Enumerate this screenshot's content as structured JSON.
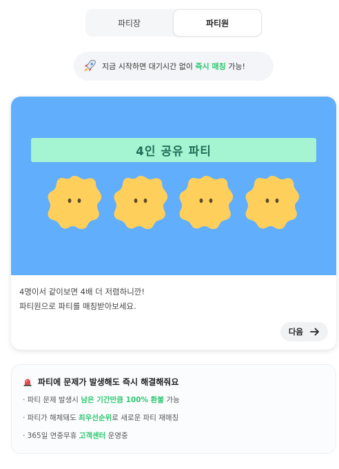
{
  "tabs": [
    {
      "label": "파티장",
      "active": false
    },
    {
      "label": "파티원",
      "active": true
    }
  ],
  "banner": {
    "icon": "rocket-icon",
    "prefix": "지금 시작하면 대기시간 없이 ",
    "highlight": "즉시 매칭",
    "suffix": " 가능!"
  },
  "card": {
    "hero_label": "4인 공유 파티",
    "hero_bg": "#61aefc",
    "members_count": 4,
    "desc_line1": "4명이서 같이보면 4배 더 저렴하니깐!",
    "desc_line2": "파티원으로 파티를 매칭받아보세요.",
    "next_label": "다음",
    "next_icon": "arrow-right-icon"
  },
  "info": {
    "icon": "alarm-siren-icon",
    "title": "파티에 문제가 발생해도 즉시 해결해줘요",
    "items": [
      {
        "prefix": "· 파티 문제 발생시 ",
        "highlight": "남은 기간만큼 100% 환불",
        "suffix": " 가능"
      },
      {
        "prefix": "· 파티가 해체돼도 ",
        "highlight": "최우선순위",
        "suffix": "로 새로운 파티 재매칭"
      },
      {
        "prefix": "· 365일 연중무휴 ",
        "highlight": "고객센터",
        "suffix": " 운영중"
      }
    ]
  },
  "colors": {
    "accent_green": "#2cc76f",
    "face_yellow": "#ffcf5c"
  }
}
